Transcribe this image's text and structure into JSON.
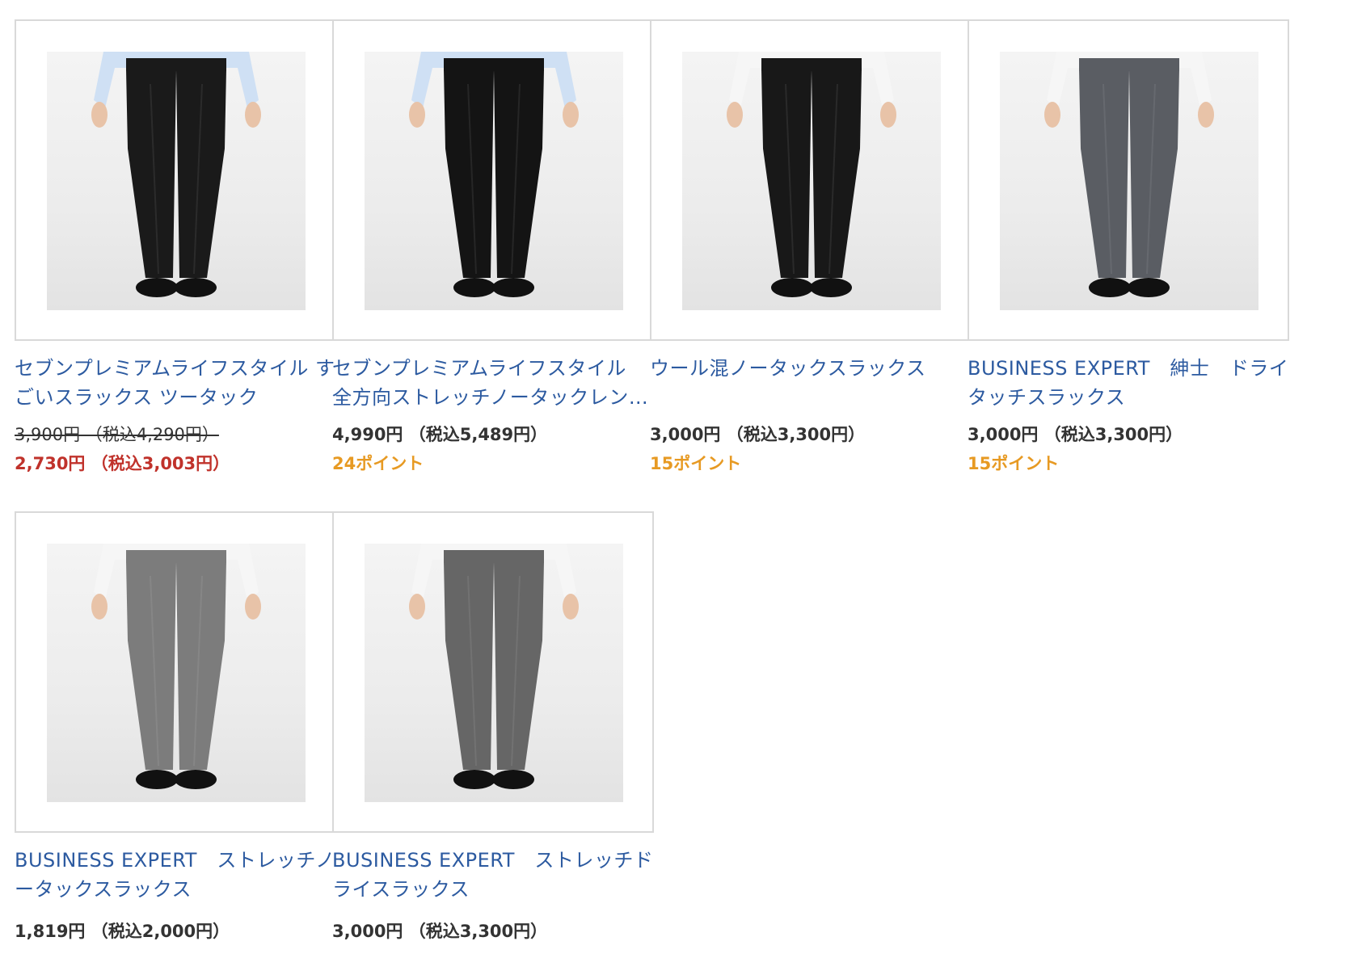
{
  "products": [
    {
      "title": "セブンプレミアムライフスタイル すごいスラックス ツータック",
      "original_price": "3,900円 （税込4,290円）",
      "price": "2,730円 （税込3,003円）",
      "points": "",
      "pants_color": "#1a1a1a",
      "shirt_color": "#cfe0f4",
      "on_sale": true
    },
    {
      "title": "セブンプレミアムライフスタイル　全方向ストレッチノータックレング…",
      "original_price": "",
      "price": "4,990円 （税込5,489円）",
      "points": "24ポイント",
      "pants_color": "#141414",
      "shirt_color": "#cfe0f4",
      "on_sale": false
    },
    {
      "title": "ウール混ノータックスラックス",
      "original_price": "",
      "price": "3,000円 （税込3,300円）",
      "points": "15ポイント",
      "pants_color": "#181818",
      "shirt_color": "#f6f6f6",
      "on_sale": false
    },
    {
      "title": "BUSINESS EXPERT　紳士　ドライタッチスラックス",
      "original_price": "",
      "price": "3,000円 （税込3,300円）",
      "points": "15ポイント",
      "pants_color": "#5a5d63",
      "shirt_color": "#f6f6f6",
      "on_sale": false
    },
    {
      "title": "BUSINESS EXPERT　ストレッチノータックスラックス",
      "original_price": "",
      "price": "1,819円 （税込2,000円）",
      "points": "",
      "pants_color": "#7c7c7c",
      "shirt_color": "#f6f6f6",
      "on_sale": false
    },
    {
      "title": "BUSINESS EXPERT　ストレッチドライスラックス",
      "original_price": "",
      "price": "3,000円 （税込3,300円）",
      "points": "",
      "pants_color": "#666666",
      "shirt_color": "#f6f6f6",
      "on_sale": false
    }
  ]
}
